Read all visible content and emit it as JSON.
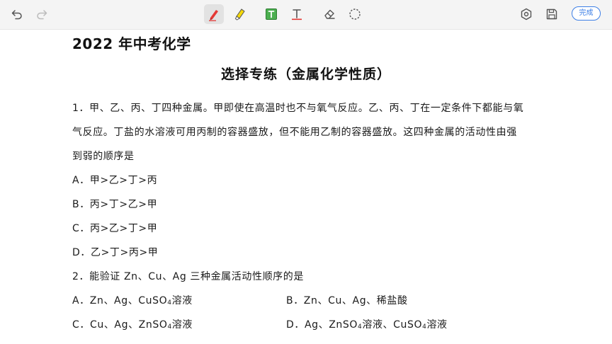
{
  "toolbar": {
    "tools": [
      {
        "name": "undo",
        "icon": "undo-icon"
      },
      {
        "name": "redo",
        "icon": "redo-icon"
      },
      {
        "name": "pen",
        "icon": "red-pen-icon",
        "color": "#e53935",
        "active": true
      },
      {
        "name": "highlighter",
        "icon": "highlighter-icon",
        "color": "#f5d90a"
      },
      {
        "name": "textbox",
        "icon": "text-box-icon",
        "color": "#2e9e4f"
      },
      {
        "name": "text",
        "icon": "text-tool-icon",
        "color": "#e53935"
      },
      {
        "name": "eraser",
        "icon": "eraser-icon"
      },
      {
        "name": "lasso",
        "icon": "lasso-icon"
      },
      {
        "name": "settings",
        "icon": "settings-icon"
      },
      {
        "name": "save",
        "icon": "save-icon"
      }
    ],
    "done_label": "完成",
    "accent": "#3d7fe6"
  },
  "document": {
    "title": "2022 年中考化学",
    "subtitle": "选择专练（金属化学性质）",
    "q1": {
      "line1": "1．甲、乙、丙、丁四种金属。甲即使在高温时也不与氧气反应。乙、丙、丁在一定条件下都能与氧",
      "line2": "气反应。丁盐的水溶液可用丙制的容器盛放，但不能用乙制的容器盛放。这四种金属的活动性由强",
      "line3": "到弱的顺序是",
      "options": [
        "A．甲>乙>丁>丙",
        "B．丙>丁>乙>甲",
        "C．丙>乙>丁>甲",
        "D．乙>丁>丙>甲"
      ]
    },
    "q2": {
      "stem": "2．能验证 Zn、Cu、Ag 三种金属活动性顺序的是",
      "a_pre": "A．Zn、Ag、CuSO",
      "a_sub": "4",
      "a_post": "溶液",
      "b": "B．Zn、Cu、Ag、稀盐酸",
      "c_pre": "C．Cu、Ag、ZnSO",
      "c_sub": "4",
      "c_post": "溶液",
      "d_pre": "D．Ag、ZnSO",
      "d_sub1": "4",
      "d_mid": "溶液、CuSO",
      "d_sub2": "4",
      "d_post": "溶液"
    }
  }
}
